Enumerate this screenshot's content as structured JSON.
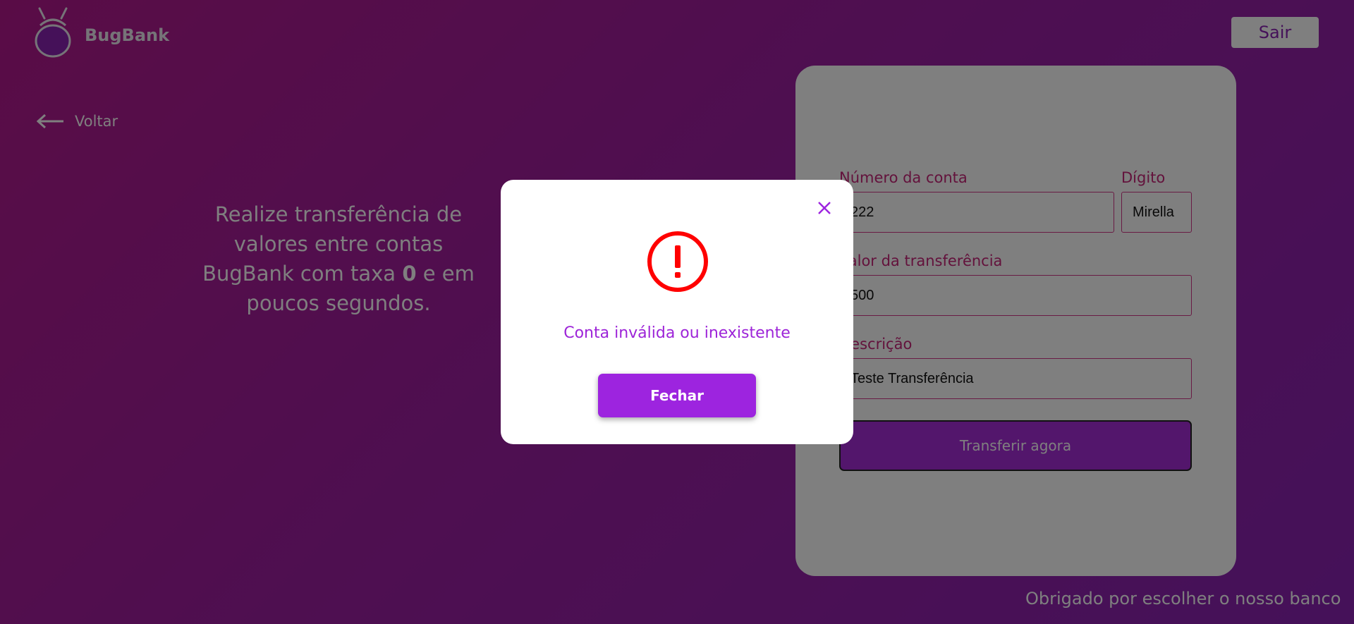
{
  "header": {
    "brand": "BugBank",
    "logout_label": "Sair"
  },
  "nav": {
    "back_label": "Voltar"
  },
  "hero": {
    "line_prefix": "Realize transferência de valores entre contas BugBank com taxa ",
    "highlight": "0",
    "line_suffix": " e em poucos segundos."
  },
  "form": {
    "account_number_label": "Número da conta",
    "account_number_value": "222",
    "digit_label": "Dígito",
    "digit_value": "Mirella",
    "amount_label": "Valor da transferência",
    "amount_value": "500",
    "description_label": "Descrição",
    "description_value": "Teste Transferência",
    "submit_label": "Transferir agora"
  },
  "footer": {
    "text": "Obrigado por escolher o nosso banco"
  },
  "modal": {
    "message": "Conta inválida ou inexistente",
    "close_button_label": "Fechar",
    "close_icon": "x-icon",
    "alert_icon": "exclamation-circle-icon",
    "alert_color": "#ff0000"
  },
  "colors": {
    "primary": "#9d24df",
    "label_pink": "#c72478"
  }
}
